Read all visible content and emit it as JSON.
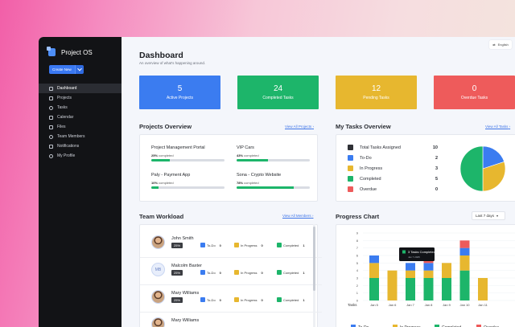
{
  "app": {
    "name": "Project OS",
    "create_label": "Create New"
  },
  "sidebar": {
    "items": [
      {
        "label": "Dashboard",
        "icon": "dashboard-icon"
      },
      {
        "label": "Projects",
        "icon": "projects-icon"
      },
      {
        "label": "Tasks",
        "icon": "tasks-icon"
      },
      {
        "label": "Calendar",
        "icon": "calendar-icon"
      },
      {
        "label": "Files",
        "icon": "files-icon"
      },
      {
        "label": "Team Members",
        "icon": "team-icon"
      },
      {
        "label": "Notifications",
        "icon": "bell-icon"
      },
      {
        "label": "My Profile",
        "icon": "profile-icon"
      }
    ]
  },
  "language": "English",
  "page": {
    "title": "Dashboard",
    "subtitle": "An overview of what's happening around."
  },
  "stats": [
    {
      "value": "5",
      "label": "Active Projects",
      "color": "#3b7cf0"
    },
    {
      "value": "24",
      "label": "Completed Tasks",
      "color": "#1db56a"
    },
    {
      "value": "12",
      "label": "Pending Tasks",
      "color": "#e7b72f"
    },
    {
      "value": "0",
      "label": "Overdue Tasks",
      "color": "#ee5b5b"
    }
  ],
  "projects_overview": {
    "title": "Projects Overview",
    "link": "View All Projects",
    "completed_word": "completed",
    "items": [
      {
        "name": "Project Management Portal",
        "percent": "25%",
        "progress": 25
      },
      {
        "name": "VIP Cars",
        "percent": "43%",
        "progress": 43
      },
      {
        "name": "Paly - Payment App",
        "percent": "10%",
        "progress": 10
      },
      {
        "name": "Sona - Crypto Website",
        "percent": "78%",
        "progress": 78
      }
    ]
  },
  "my_tasks": {
    "title": "My Tasks Overview",
    "link": "View All Tasks",
    "rows": [
      {
        "label": "Total Tasks Assigned",
        "value": "10",
        "color": "#2f3136"
      },
      {
        "label": "To-Do",
        "value": "2",
        "color": "#3b7cf0"
      },
      {
        "label": "In Progress",
        "value": "3",
        "color": "#e7b72f"
      },
      {
        "label": "Completed",
        "value": "5",
        "color": "#1db56a"
      },
      {
        "label": "Overdue",
        "value": "0",
        "color": "#ee5b5b"
      }
    ]
  },
  "team_workload": {
    "title": "Team Workload",
    "link": "View All Members",
    "labels": {
      "todo": "To-Do",
      "progress": "In Progress",
      "completed": "Completed"
    },
    "members": [
      {
        "name": "John Smith",
        "percent": "25%",
        "todo": "0",
        "progress": "0",
        "completed": "1",
        "initials": ""
      },
      {
        "name": "Malcolm Baxter",
        "percent": "25%",
        "todo": "0",
        "progress": "0",
        "completed": "1",
        "initials": "MB"
      },
      {
        "name": "Mary Williams",
        "percent": "25%",
        "todo": "0",
        "progress": "0",
        "completed": "1",
        "initials": ""
      },
      {
        "name": "Mary Williams",
        "percent": "",
        "todo": "",
        "progress": "",
        "completed": "",
        "initials": ""
      }
    ]
  },
  "progress_chart": {
    "title": "Progress Chart",
    "range": "Last 7 days",
    "ylabel": "Tasks",
    "tooltip": {
      "title": "3 Tasks Completed",
      "date": "Jan 7 2025"
    },
    "legend": [
      "To-Do",
      "In Progress",
      "Completed",
      "Overdue"
    ]
  },
  "chart_data": [
    {
      "type": "pie",
      "labels": [
        "To-Do",
        "In Progress",
        "Completed",
        "Overdue"
      ],
      "values": [
        2,
        3,
        5,
        0
      ],
      "colors": [
        "#3b7cf0",
        "#e7b72f",
        "#1db56a",
        "#ee5b5b"
      ]
    },
    {
      "type": "bar",
      "stacked": true,
      "title": "Progress Chart",
      "ylabel": "Tasks",
      "categories": [
        "Jan 5",
        "Jan 6",
        "Jan 7",
        "Jan 8",
        "Jan 9",
        "Jan 10",
        "Jan 11"
      ],
      "series": [
        {
          "name": "Completed",
          "color": "#1db56a",
          "values": [
            3,
            0,
            3,
            3,
            3,
            4,
            0
          ]
        },
        {
          "name": "In Progress",
          "color": "#e7b72f",
          "values": [
            2,
            4,
            1,
            1,
            2,
            2,
            3
          ]
        },
        {
          "name": "To-Do",
          "color": "#3b7cf0",
          "values": [
            1,
            0,
            1,
            1,
            0,
            1,
            0
          ]
        },
        {
          "name": "Overdue",
          "color": "#ee5b5b",
          "values": [
            0,
            0,
            0,
            1,
            0,
            1,
            0
          ]
        }
      ],
      "ylim": [
        0,
        9
      ]
    }
  ]
}
